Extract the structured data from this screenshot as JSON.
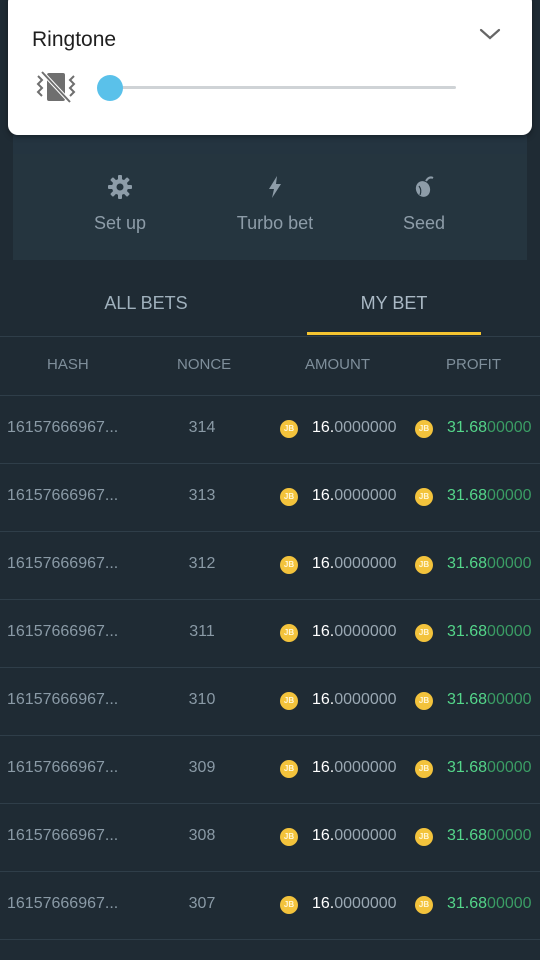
{
  "volume": {
    "title": "Ringtone",
    "level": 0,
    "muted": true,
    "icons": [
      "vibrate-mute-icon",
      "chevron-down-icon"
    ]
  },
  "actions": [
    {
      "label": "Set up",
      "icon": "gear-icon"
    },
    {
      "label": "Turbo bet",
      "icon": "lightning-icon"
    },
    {
      "label": "Seed",
      "icon": "seed-icon"
    }
  ],
  "tabs": {
    "all": "ALL BETS",
    "my": "MY BET",
    "active": "my"
  },
  "table": {
    "headers": {
      "hash": "HASH",
      "nonce": "NONCE",
      "amount": "AMOUNT",
      "profit": "PROFIT"
    },
    "coin_label": "JB",
    "rows": [
      {
        "hash": "16157666967...",
        "nonce": "314",
        "amount_int": "16.",
        "amount_dec": "0000000",
        "profit_int": "31.68",
        "profit_dec": "00000"
      },
      {
        "hash": "16157666967...",
        "nonce": "313",
        "amount_int": "16.",
        "amount_dec": "0000000",
        "profit_int": "31.68",
        "profit_dec": "00000"
      },
      {
        "hash": "16157666967...",
        "nonce": "312",
        "amount_int": "16.",
        "amount_dec": "0000000",
        "profit_int": "31.68",
        "profit_dec": "00000"
      },
      {
        "hash": "16157666967...",
        "nonce": "311",
        "amount_int": "16.",
        "amount_dec": "0000000",
        "profit_int": "31.68",
        "profit_dec": "00000"
      },
      {
        "hash": "16157666967...",
        "nonce": "310",
        "amount_int": "16.",
        "amount_dec": "0000000",
        "profit_int": "31.68",
        "profit_dec": "00000"
      },
      {
        "hash": "16157666967...",
        "nonce": "309",
        "amount_int": "16.",
        "amount_dec": "0000000",
        "profit_int": "31.68",
        "profit_dec": "00000"
      },
      {
        "hash": "16157666967...",
        "nonce": "308",
        "amount_int": "16.",
        "amount_dec": "0000000",
        "profit_int": "31.68",
        "profit_dec": "00000"
      },
      {
        "hash": "16157666967...",
        "nonce": "307",
        "amount_int": "16.",
        "amount_dec": "0000000",
        "profit_int": "31.68",
        "profit_dec": "00000"
      }
    ]
  },
  "colors": {
    "background": "#1f2b34",
    "accent": "#f4c430",
    "profit": "#54d68a",
    "slider": "#5ac1ea"
  }
}
